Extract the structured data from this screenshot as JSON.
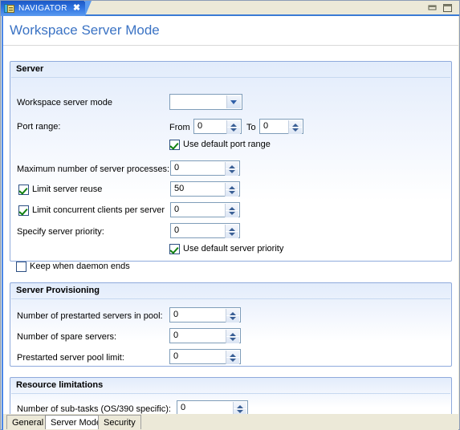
{
  "window": {
    "tab": {
      "icon": "navigator-icon",
      "label": "NAVIGATOR",
      "close": "✖"
    },
    "minimize_icon": "minimize-icon",
    "maximize_icon": "maximize-icon"
  },
  "page": {
    "title": "Workspace Server Mode"
  },
  "sections": {
    "server": {
      "title": "Server",
      "fields": {
        "workspace_server_mode": {
          "label": "Workspace server mode",
          "value": "",
          "arrow_icon": "chevron-down-icon"
        },
        "port_range": {
          "label": "Port range:",
          "from_label": "From",
          "from_value": "0",
          "to_label": "To",
          "to_value": "0"
        },
        "use_default_port_range": {
          "label": "Use default port range",
          "checked": true
        },
        "max_server_processes": {
          "label": "Maximum number of server processes:",
          "value": "0"
        },
        "limit_server_reuse": {
          "label": "Limit server reuse",
          "checked": true,
          "value": "50"
        },
        "limit_concurrent_clients": {
          "label": "Limit concurrent clients per server",
          "checked": true,
          "value": "0"
        },
        "specify_server_priority": {
          "label": "Specify server priority:",
          "value": "0"
        },
        "use_default_server_priority": {
          "label": "Use  default server priority",
          "checked": true
        },
        "keep_when_daemon_ends": {
          "label": "Keep when daemon ends",
          "checked": false
        }
      }
    },
    "provisioning": {
      "title": "Server Provisioning",
      "fields": {
        "prestarted_servers_in_pool": {
          "label": "Number of prestarted servers in pool:",
          "value": "0"
        },
        "spare_servers": {
          "label": "Number of spare servers:",
          "value": "0"
        },
        "prestarted_pool_limit": {
          "label": "Prestarted server pool limit:",
          "value": "0"
        }
      }
    },
    "resource": {
      "title": "Resource limitations",
      "fields": {
        "sub_tasks": {
          "label": "Number of sub-tasks (OS/390 specific):",
          "value": "0"
        }
      }
    }
  },
  "bottom_tabs": {
    "items": [
      {
        "label": "General",
        "selected": false
      },
      {
        "label": "Server Mode",
        "selected": true
      },
      {
        "label": "Security",
        "selected": false
      }
    ]
  },
  "colors": {
    "tab_blue": "#2f73e0",
    "title_blue": "#3b73c4",
    "section_border": "#8faadc",
    "check_green": "#108010",
    "chrome": "#ece9d8"
  }
}
